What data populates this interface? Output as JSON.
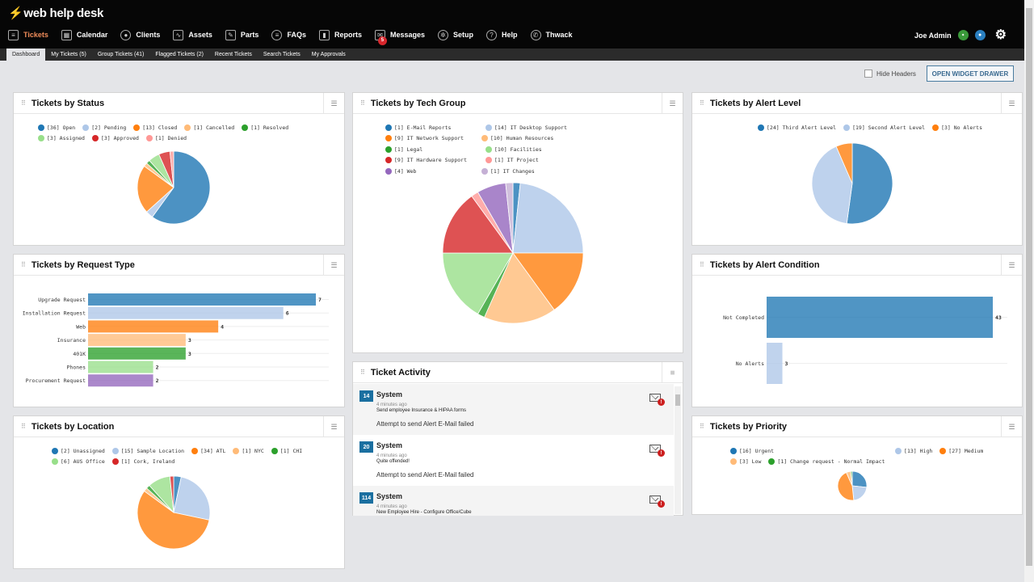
{
  "app": {
    "logo_text": "web help desk"
  },
  "nav": [
    {
      "label": "Tickets",
      "icon": "list-icon",
      "glyph": "≡",
      "active": true
    },
    {
      "label": "Calendar",
      "icon": "calendar-icon",
      "glyph": "▦"
    },
    {
      "label": "Clients",
      "icon": "user-icon",
      "glyph": "●",
      "round": true
    },
    {
      "label": "Assets",
      "icon": "monitor-icon",
      "glyph": "∿"
    },
    {
      "label": "Parts",
      "icon": "wrench-icon",
      "glyph": "✎"
    },
    {
      "label": "FAQs",
      "icon": "faq-list-icon",
      "glyph": "≡",
      "round": true
    },
    {
      "label": "Reports",
      "icon": "report-icon",
      "glyph": "▮"
    },
    {
      "label": "Messages",
      "icon": "envelope-icon",
      "glyph": "✉",
      "badge": "5"
    },
    {
      "label": "Setup",
      "icon": "setup-gear-icon",
      "glyph": "✲",
      "round": true
    },
    {
      "label": "Help",
      "icon": "help-icon",
      "glyph": "?",
      "round": true
    },
    {
      "label": "Thwack",
      "icon": "thwack-icon",
      "glyph": "✆",
      "round": true
    }
  ],
  "user": {
    "name": "Joe Admin"
  },
  "subnav": [
    {
      "label": "Dashboard",
      "active": true
    },
    {
      "label": "My Tickets (5)"
    },
    {
      "label": "Group Tickets (41)"
    },
    {
      "label": "Flagged Tickets (2)"
    },
    {
      "label": "Recent Tickets"
    },
    {
      "label": "Search Tickets"
    },
    {
      "label": "My Approvals"
    }
  ],
  "toolbar": {
    "hide_headers_label": "Hide Headers",
    "hide_headers_checked": false,
    "open_drawer_label": "OPEN WIDGET DRAWER"
  },
  "widgets": {
    "status": {
      "title": "Tickets by Status"
    },
    "techgroup": {
      "title": "Tickets by Tech Group"
    },
    "alertlevel": {
      "title": "Tickets by Alert Level"
    },
    "requesttype": {
      "title": "Tickets by Request Type"
    },
    "alertcond": {
      "title": "Tickets by Alert Condition"
    },
    "location": {
      "title": "Tickets by Location"
    },
    "activity": {
      "title": "Ticket Activity"
    },
    "priority": {
      "title": "Tickets by Priority"
    }
  },
  "activity": [
    {
      "ticket": "14",
      "author": "System",
      "time": "4 minutes ago",
      "subject": "Send employee Insurance & HIPAA forms",
      "message": "Attempt to send Alert E-Mail failed"
    },
    {
      "ticket": "20",
      "author": "System",
      "time": "4 minutes ago",
      "subject": "Quite offended!",
      "message": "Attempt to send Alert E-Mail failed"
    },
    {
      "ticket": "114",
      "author": "System",
      "time": "4 minutes ago",
      "subject": "New Employee Hire - Configure Office/Cube",
      "message": ""
    }
  ],
  "chart_data": [
    {
      "id": "status",
      "type": "pie",
      "title": "Tickets by Status",
      "labels": [
        "Open",
        "Pending",
        "Closed",
        "Cancelled",
        "Resolved",
        "Assigned",
        "Approved",
        "Denied"
      ],
      "values": [
        36,
        2,
        13,
        1,
        1,
        3,
        3,
        1
      ],
      "colors": [
        "#1f77b4",
        "#aec7e8",
        "#ff7f0e",
        "#ffbb78",
        "#2ca02c",
        "#98df8a",
        "#d62728",
        "#ff9896"
      ],
      "legend": "top"
    },
    {
      "id": "techgroup",
      "type": "pie",
      "title": "Tickets by Tech Group",
      "labels": [
        "E-Mail Reports",
        "IT Desktop Support",
        "IT Network Support",
        "Human Resources",
        "Legal",
        "Facilities",
        "IT Hardware Support",
        "IT Project",
        "Web",
        "IT Changes"
      ],
      "values": [
        1,
        14,
        9,
        10,
        1,
        10,
        9,
        1,
        4,
        1
      ],
      "colors": [
        "#1f77b4",
        "#aec7e8",
        "#ff7f0e",
        "#ffbb78",
        "#2ca02c",
        "#98df8a",
        "#d62728",
        "#ff9896",
        "#9467bd",
        "#c5b0d5"
      ],
      "legend": "top"
    },
    {
      "id": "alertlevel",
      "type": "pie",
      "title": "Tickets by Alert Level",
      "labels": [
        "Third Alert Level",
        "Second Alert Level",
        "No Alerts"
      ],
      "values": [
        24,
        19,
        3
      ],
      "colors": [
        "#1f77b4",
        "#aec7e8",
        "#ff7f0e"
      ],
      "legend": "top"
    },
    {
      "id": "requesttype",
      "type": "bar",
      "orientation": "horizontal",
      "title": "Tickets by Request Type",
      "categories": [
        "Upgrade Request",
        "Installation Request",
        "Web",
        "Insurance",
        "401K",
        "Phones",
        "Procurement Request"
      ],
      "values": [
        7,
        6,
        4,
        3,
        3,
        2,
        2
      ],
      "colors": [
        "#1f77b4",
        "#aec7e8",
        "#ff7f0e",
        "#ffbb78",
        "#2ca02c",
        "#98df8a",
        "#9467bd"
      ],
      "xlim": [
        0,
        7
      ]
    },
    {
      "id": "alertcond",
      "type": "bar",
      "orientation": "horizontal",
      "title": "Tickets by Alert Condition",
      "categories": [
        "Not Completed",
        "No Alerts"
      ],
      "values": [
        43,
        3
      ],
      "colors": [
        "#1f77b4",
        "#aec7e8"
      ],
      "xlim": [
        0,
        43
      ]
    },
    {
      "id": "location",
      "type": "pie",
      "title": "Tickets by Location",
      "labels": [
        "Unassigned",
        "Sample Location",
        "ATL",
        "NYC",
        "CHI",
        "AUS Office",
        "Cork, Ireland"
      ],
      "values": [
        2,
        15,
        34,
        1,
        1,
        6,
        1
      ],
      "colors": [
        "#1f77b4",
        "#aec7e8",
        "#ff7f0e",
        "#ffbb78",
        "#2ca02c",
        "#98df8a",
        "#d62728"
      ],
      "legend": "top"
    },
    {
      "id": "priority",
      "type": "pie",
      "title": "Tickets by Priority",
      "labels": [
        "Urgent",
        "High",
        "Medium",
        "Low",
        "Change request - Normal Impact"
      ],
      "values": [
        16,
        13,
        27,
        3,
        1
      ],
      "colors": [
        "#1f77b4",
        "#aec7e8",
        "#ff7f0e",
        "#ffbb78",
        "#2ca02c"
      ],
      "legend": "top"
    }
  ]
}
